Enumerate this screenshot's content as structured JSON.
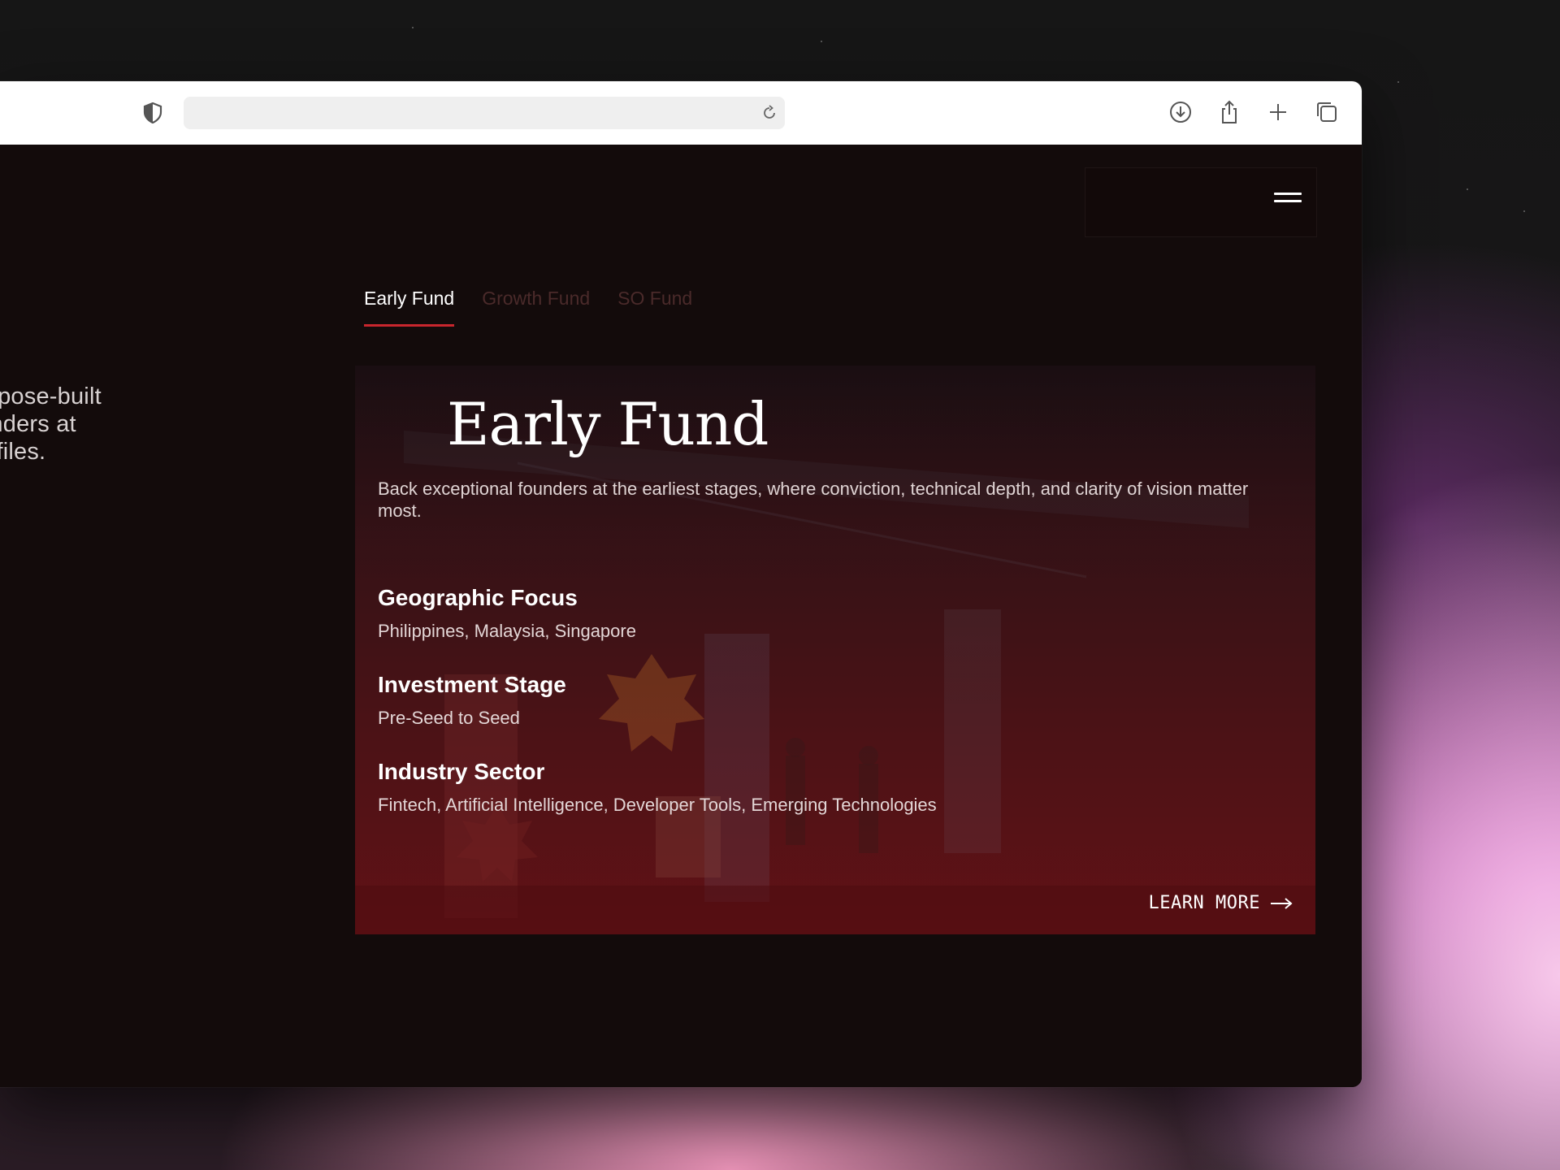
{
  "browser": {
    "address_text": ""
  },
  "sidebar_text": {
    "lines": [
      "e purpose-built",
      "t founders at",
      "y profiles."
    ]
  },
  "tabs": [
    {
      "label": "Early Fund",
      "active": true
    },
    {
      "label": "Growth Fund",
      "active": false
    },
    {
      "label": "SO Fund",
      "active": false
    }
  ],
  "card": {
    "title": "Early Fund",
    "description": "Back exceptional founders at the earliest stages, where conviction, technical depth, and clarity of vision matter most.",
    "sections": [
      {
        "heading": "Geographic Focus",
        "value": "Philippines, Malaysia, Singapore"
      },
      {
        "heading": "Investment Stage",
        "value": "Pre-Seed to Seed"
      },
      {
        "heading": "Industry Sector",
        "value": "Fintech, Artificial Intelligence, Developer Tools, Emerging Technologies"
      }
    ],
    "cta_label": "LEARN MORE",
    "cta_icon": "arrow-right-icon"
  },
  "colors": {
    "accent": "#c8262d",
    "page_background": "#130b0b",
    "card_red": "#711115"
  },
  "icons": {
    "toolbar": [
      "shield-icon",
      "reload-icon",
      "download-icon",
      "share-icon",
      "new-tab-icon",
      "tabs-overview-icon"
    ],
    "menu": "hamburger-menu-icon"
  }
}
